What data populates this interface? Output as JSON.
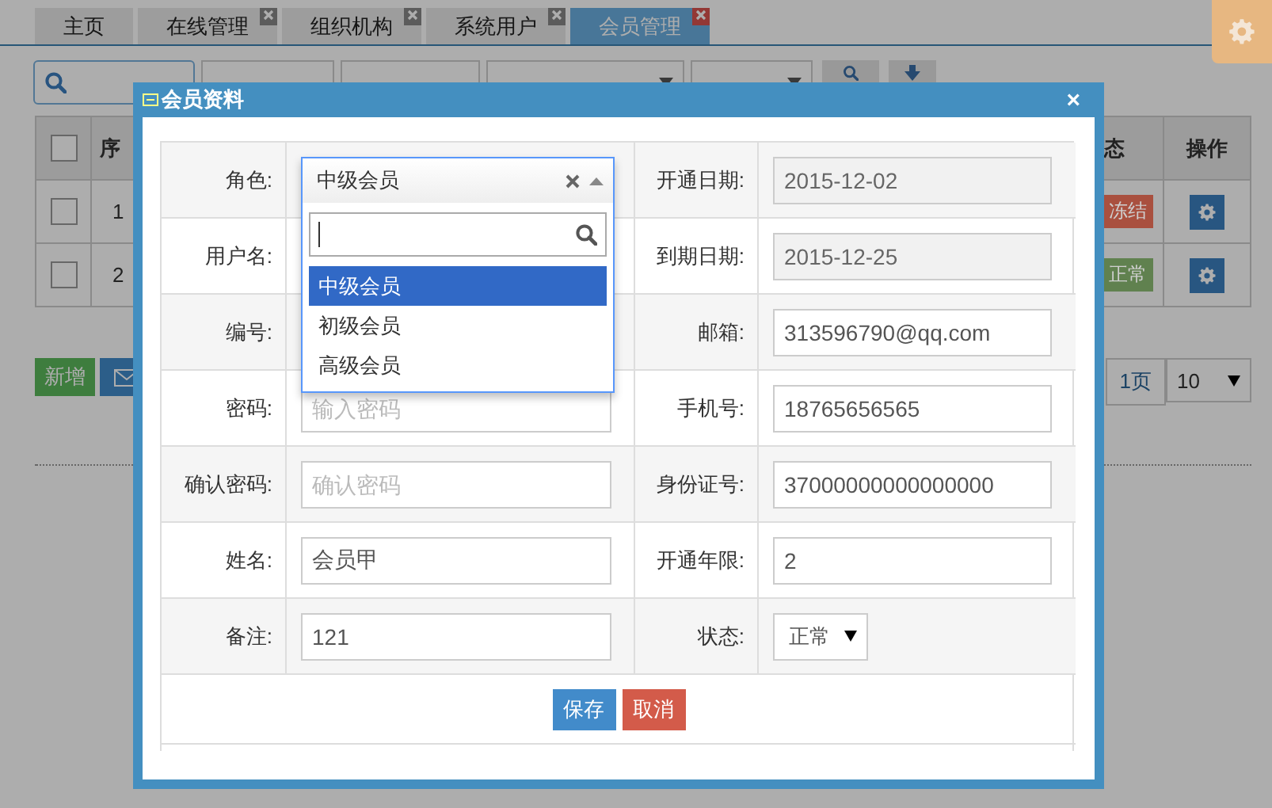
{
  "background_page": {
    "tabs": [
      {
        "label": "主页",
        "selected": false,
        "closable": false
      },
      {
        "label": "在线管理",
        "selected": false,
        "closable": true
      },
      {
        "label": "组织机构",
        "selected": false,
        "closable": true
      },
      {
        "label": "系统用户",
        "selected": false,
        "closable": true
      },
      {
        "label": "会员管理",
        "selected": true,
        "closable": true
      }
    ],
    "table": {
      "columns": [
        "序",
        "态",
        "操作"
      ],
      "all_checked": false,
      "rows": [
        {
          "checked": false,
          "number": "1",
          "status": "冻结",
          "color": "#a9503f"
        },
        {
          "checked": false,
          "number": "2",
          "status": "正常",
          "color": "#60814f"
        }
      ]
    },
    "add_button": "新增",
    "pagination": {
      "pages": "1页",
      "page_size": "10"
    }
  },
  "dialog": {
    "title": "会员资料",
    "close": "×",
    "fields": [
      {
        "label": "角色:",
        "kind": "role-select",
        "value": "中级会员",
        "expanded": true,
        "options": [
          {
            "label": "中级会员",
            "selected": true
          },
          {
            "label": "初级会员",
            "selected": false
          },
          {
            "label": "高级会员",
            "selected": false
          }
        ]
      },
      {
        "label": "开通日期:",
        "kind": "readonly",
        "value": "2015-12-02"
      },
      {
        "label": "用户名:",
        "kind": "covered"
      },
      {
        "label": "到期日期:",
        "kind": "readonly",
        "value": "2015-12-25"
      },
      {
        "label": "编号:",
        "kind": "covered"
      },
      {
        "label": "邮箱:",
        "kind": "text",
        "value": "313596790@qq.com"
      },
      {
        "label": "密码:",
        "kind": "text",
        "placeholder": "输入密码"
      },
      {
        "label": "手机号:",
        "kind": "text",
        "value": "18765656565"
      },
      {
        "label": "确认密码:",
        "kind": "text",
        "placeholder": "确认密码"
      },
      {
        "label": "身份证号:",
        "kind": "text",
        "value": "37000000000000000"
      },
      {
        "label": "姓名:",
        "kind": "text",
        "value": "会员甲"
      },
      {
        "label": "开通年限:",
        "kind": "text",
        "value": "2"
      },
      {
        "label": "备注:",
        "kind": "text",
        "value": "121"
      },
      {
        "label": "状态:",
        "kind": "select",
        "value": "正常"
      }
    ],
    "buttons": [
      {
        "label": "保存",
        "kind": "primary"
      },
      {
        "label": "取消",
        "kind": "danger"
      }
    ]
  }
}
